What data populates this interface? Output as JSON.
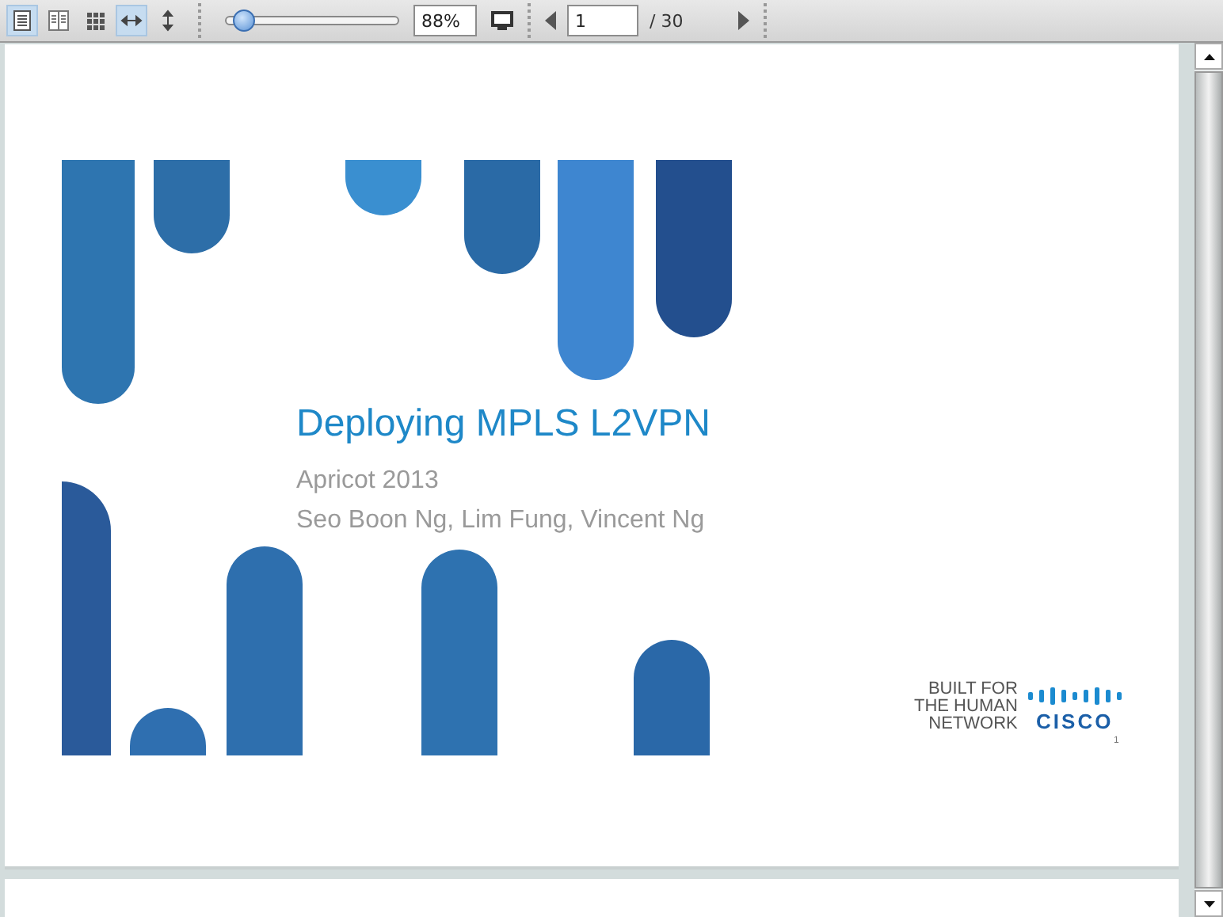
{
  "toolbar": {
    "view_buttons": [
      {
        "kind": "single",
        "selected": true
      },
      {
        "kind": "facing",
        "selected": false
      },
      {
        "kind": "grid",
        "selected": false
      },
      {
        "kind": "fit-width",
        "selected": true
      },
      {
        "kind": "fit-height",
        "selected": false
      }
    ],
    "zoom": {
      "level": 0.1,
      "value": "88%"
    },
    "page": {
      "value": "1",
      "total": "/ 30"
    }
  },
  "slide": {
    "title": "Deploying MPLS L2VPN",
    "subtitle": "Apricot 2013",
    "authors": "Seo Boon Ng, Lim Fung, Vincent Ng",
    "logo": {
      "tagline": [
        "BUILT FOR",
        "THE HUMAN",
        "NETWORK"
      ],
      "brand": "CISCO"
    },
    "slide_number": "1"
  }
}
